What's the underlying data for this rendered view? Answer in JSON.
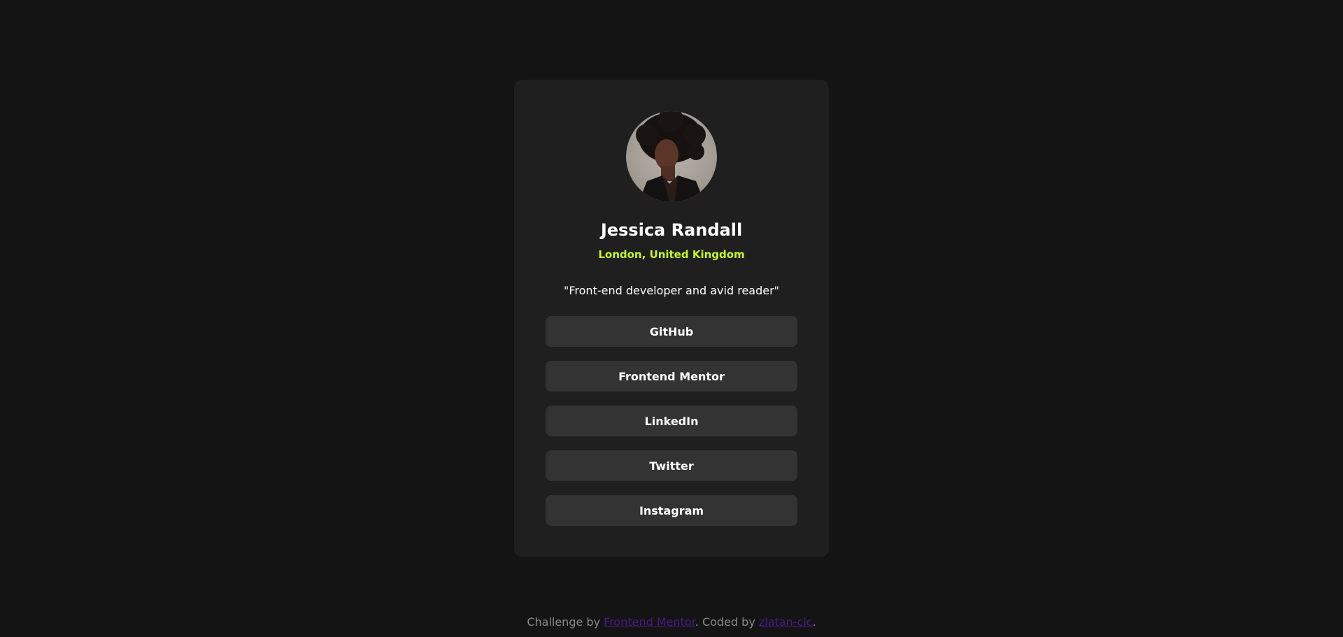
{
  "profile": {
    "name": "Jessica Randall",
    "location": "London, United Kingdom",
    "bio": "\"Front-end developer and avid reader\"",
    "avatar_icon": "profile-photo"
  },
  "links": [
    {
      "label": "GitHub"
    },
    {
      "label": "Frontend Mentor"
    },
    {
      "label": "LinkedIn"
    },
    {
      "label": "Twitter"
    },
    {
      "label": "Instagram"
    }
  ],
  "footer": {
    "prefix": "Challenge by ",
    "challenge_link": "Frontend Mentor",
    "middle": ". Coded by ",
    "author_link": "zlatan-cic",
    "suffix": "."
  },
  "colors": {
    "background": "#141414",
    "card": "#1f1f1f",
    "button": "#333333",
    "accent_green": "#c5f82a",
    "footer_link": "#4b1a85"
  }
}
